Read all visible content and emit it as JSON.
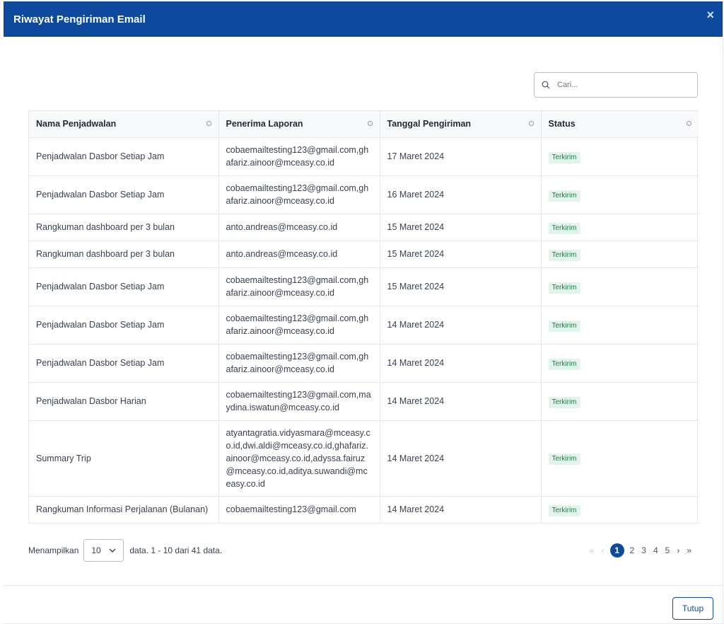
{
  "modal": {
    "title": "Riwayat Pengiriman Email",
    "close_icon": "×"
  },
  "search": {
    "placeholder": "Cari..."
  },
  "table": {
    "headers": [
      "Nama Penjadwalan",
      "Penerima Laporan",
      "Tanggal Pengiriman",
      "Status"
    ],
    "rows": [
      {
        "name": "Penjadwalan Dasbor Setiap Jam",
        "recipients": "cobaemailtesting123@gmail.com,ghafariz.ainoor@mceasy.co.id",
        "date": "17 Maret 2024",
        "status": "Terkirim"
      },
      {
        "name": "Penjadwalan Dasbor Setiap Jam",
        "recipients": "cobaemailtesting123@gmail.com,ghafariz.ainoor@mceasy.co.id",
        "date": "16 Maret 2024",
        "status": "Terkirim"
      },
      {
        "name": "Rangkuman dashboard per 3 bulan",
        "recipients": "anto.andreas@mceasy.co.id",
        "date": "15 Maret 2024",
        "status": "Terkirim"
      },
      {
        "name": "Rangkuman dashboard per 3 bulan",
        "recipients": "anto.andreas@mceasy.co.id",
        "date": "15 Maret 2024",
        "status": "Terkirim"
      },
      {
        "name": "Penjadwalan Dasbor Setiap Jam",
        "recipients": "cobaemailtesting123@gmail.com,ghafariz.ainoor@mceasy.co.id",
        "date": "15 Maret 2024",
        "status": "Terkirim"
      },
      {
        "name": "Penjadwalan Dasbor Setiap Jam",
        "recipients": "cobaemailtesting123@gmail.com,ghafariz.ainoor@mceasy.co.id",
        "date": "14 Maret 2024",
        "status": "Terkirim"
      },
      {
        "name": "Penjadwalan Dasbor Setiap Jam",
        "recipients": "cobaemailtesting123@gmail.com,ghafariz.ainoor@mceasy.co.id",
        "date": "14 Maret 2024",
        "status": "Terkirim"
      },
      {
        "name": "Penjadwalan Dasbor Harian",
        "recipients": "cobaemailtesting123@gmail.com,maydina.iswatun@mceasy.co.id",
        "date": "14 Maret 2024",
        "status": "Terkirim"
      },
      {
        "name": "Summary Trip",
        "recipients": "atyantagratia.vidyasmara@mceasy.co.id,dwi.aldi@mceasy.co.id,ghafariz.ainoor@mceasy.co.id,adyssa.fairuz@mceasy.co.id,aditya.suwandi@mceasy.co.id",
        "date": "14 Maret 2024",
        "status": "Terkirim"
      },
      {
        "name": "Rangkuman Informasi Perjalanan (Bulanan)",
        "recipients": "cobaemailtesting123@gmail.com",
        "date": "14 Maret 2024",
        "status": "Terkirim"
      }
    ]
  },
  "footer": {
    "showing_label": "Menampilkan",
    "page_size": "10",
    "summary": "data.  1 - 10 dari 41 data."
  },
  "pagination": {
    "first": "«",
    "prev": "‹",
    "pages": [
      "1",
      "2",
      "3",
      "4",
      "5"
    ],
    "active_page": "1",
    "next": "›",
    "last": "»"
  },
  "actions": {
    "close_label": "Tutup"
  },
  "colors": {
    "primary": "#0d4a9e",
    "badge_bg": "#e3f4ea",
    "badge_text": "#1f7a45"
  },
  "icons": {
    "search": "search-icon",
    "sort": "sort-icon",
    "dropdown": "chevron-down-icon",
    "close": "close-icon"
  }
}
